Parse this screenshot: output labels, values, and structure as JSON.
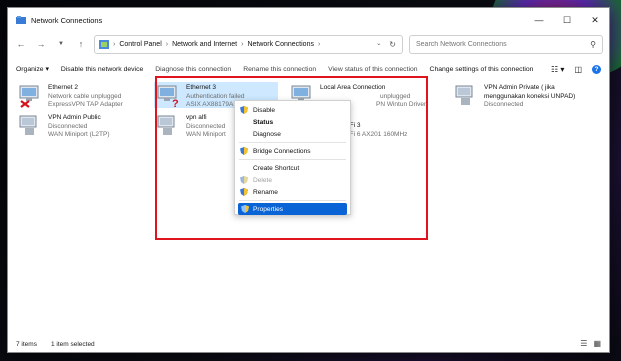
{
  "window": {
    "title": "Network Connections"
  },
  "nav": {
    "breadcrumb": [
      "Control Panel",
      "Network and Internet",
      "Network Connections"
    ],
    "search_placeholder": "Search Network Connections"
  },
  "commands": {
    "organize": "Organize ▾",
    "disable": "Disable this network device",
    "diagnose": "Diagnose this connection",
    "rename": "Rename this connection",
    "view_status": "View status of this connection",
    "change_settings": "Change settings of this connection"
  },
  "connections": [
    {
      "name": "Ethernet 2",
      "status": "Network cable unplugged",
      "device": "ExpressVPN TAP Adapter"
    },
    {
      "name": "Ethernet 3",
      "status": "Authentication failed",
      "device": "ASIX AX88179A"
    },
    {
      "name": "Local Area Connection",
      "status": "unplugged",
      "device": "PN Wintun Driver"
    },
    {
      "name": "VPN Admin Private ( jika",
      "status": "menggunakan koneksi UNPAD)",
      "device": "Disconnected"
    },
    {
      "name": "VPN Admin Public",
      "status": "Disconnected",
      "device": "WAN Miniport (L2TP)"
    },
    {
      "name": "vpn alfi",
      "status": "Disconnected",
      "device": "WAN Miniport"
    },
    {
      "name": "i-Fi 3",
      "status": "",
      "device": "i-Fi 6 AX201 160MHz"
    }
  ],
  "context_menu": {
    "disable": "Disable",
    "status": "Status",
    "diagnose": "Diagnose",
    "bridge": "Bridge Connections",
    "shortcut": "Create Shortcut",
    "delete": "Delete",
    "rename": "Rename",
    "properties": "Properties"
  },
  "statusbar": {
    "items": "7 items",
    "selected": "1 item selected"
  },
  "colors": {
    "highlight": "#0a64d6",
    "selection": "#cde8ff",
    "annotation_box": "#e0141e"
  }
}
